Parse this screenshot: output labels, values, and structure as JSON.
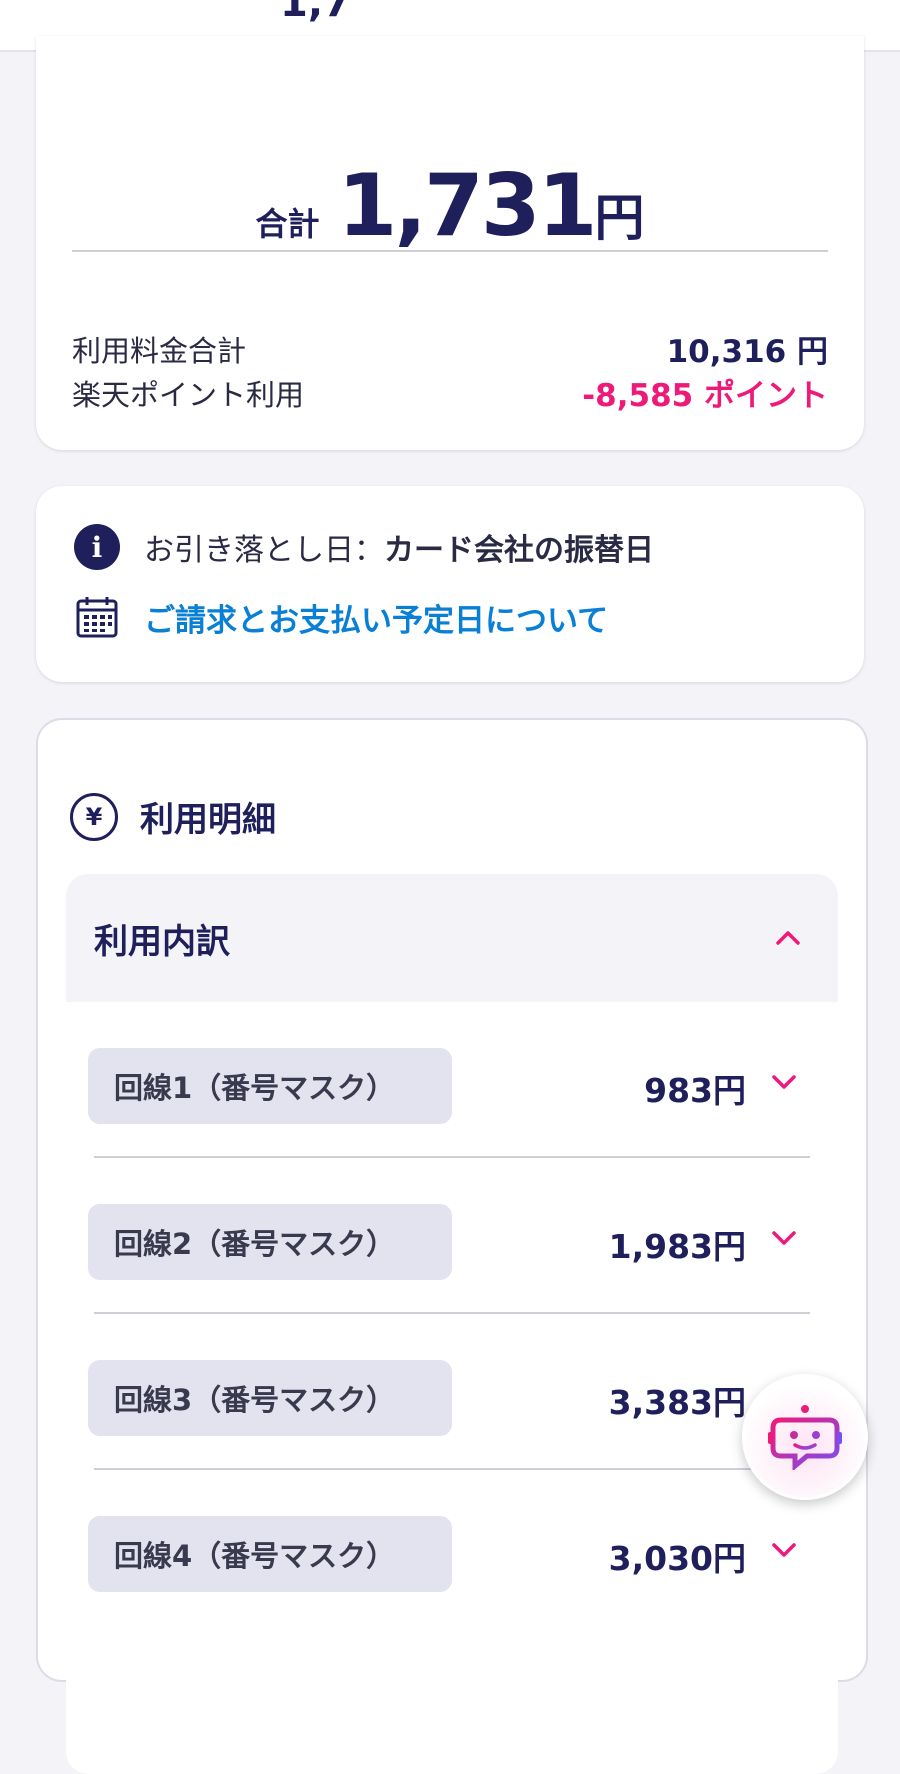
{
  "header": {
    "partial_text": "1,7"
  },
  "summary": {
    "total_label": "合計",
    "total_amount": "1,731",
    "total_unit": "円",
    "usage_label": "利用料金合計",
    "usage_value": "10,316 円",
    "points_label": "楽天ポイント利用",
    "points_value": "-8,585 ポイント"
  },
  "payment_info": {
    "debit_label": "お引き落とし日：",
    "debit_value": "カード会社の振替日",
    "schedule_link": "ご請求とお支払い予定日について"
  },
  "details": {
    "section_title": "利用明細",
    "accordion_title": "利用内訳",
    "lines": [
      {
        "label": "回線1（番号マスク）",
        "amount": "983円"
      },
      {
        "label": "回線2（番号マスク）",
        "amount": "1,983円"
      },
      {
        "label": "回線3（番号マスク）",
        "amount": "3,383円"
      },
      {
        "label": "回線4（番号マスク）",
        "amount": "3,030円"
      }
    ]
  },
  "colors": {
    "navy": "#1f1f5c",
    "pink": "#ee1a7a",
    "link_blue": "#0a7fd6"
  },
  "icons": {
    "info": "info-icon",
    "calendar": "calendar-icon",
    "yen": "yen-icon",
    "chevron_up": "chevron-up-icon",
    "chevron_down": "chevron-down-icon",
    "bot": "chatbot-icon"
  }
}
